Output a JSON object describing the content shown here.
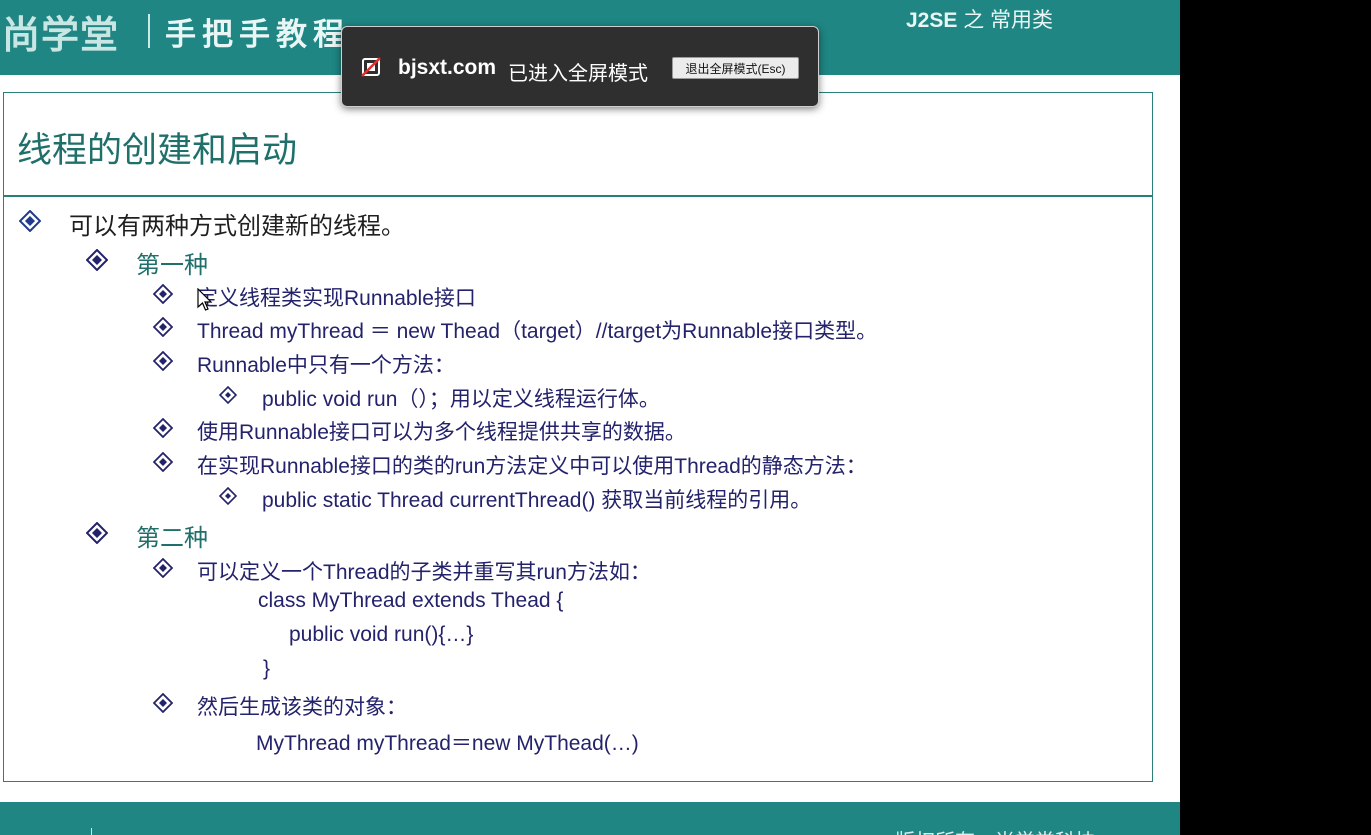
{
  "header": {
    "logo": "尚学堂",
    "motto": "手把手教程",
    "course_prefix": "J2SE",
    "course_suffix": "之 常用类"
  },
  "slide": {
    "title": "线程的创建和启动",
    "bullets": [
      {
        "level": 0,
        "text": "可以有两种方式创建新的线程。"
      },
      {
        "level": 1,
        "text": "第一种"
      },
      {
        "level": 2,
        "text": "定义线程类实现Runnable接口"
      },
      {
        "level": 2,
        "text": "Thread myThread ＝ new Thead（target）//target为Runnable接口类型。"
      },
      {
        "level": 2,
        "text": "Runnable中只有一个方法："
      },
      {
        "level": 3,
        "text": "public void run（）；用以定义线程运行体。"
      },
      {
        "level": 2,
        "text": "使用Runnable接口可以为多个线程提供共享的数据。"
      },
      {
        "level": 2,
        "text": "在实现Runnable接口的类的run方法定义中可以使用Thread的静态方法："
      },
      {
        "level": 3,
        "text": "public static Thread currentThread()  获取当前线程的引用。"
      },
      {
        "level": 1,
        "text": "第二种"
      },
      {
        "level": 2,
        "text": "可以定义一个Thread的子类并重写其run方法如："
      },
      {
        "level": -1,
        "text": "class MyThread extends Thead {"
      },
      {
        "level": -1,
        "text": "public void run(){…}"
      },
      {
        "level": -1,
        "text": "}"
      },
      {
        "level": 2,
        "text": "然后生成该类的对象："
      },
      {
        "level": -1,
        "text": "MyThread myThread＝new MyThead(…)"
      }
    ]
  },
  "footer": {
    "text": "版权所有：尚学堂科技"
  },
  "fullscreen_toast": {
    "domain": "bjsxt.com",
    "message": "已进入全屏模式",
    "exit_label": "退出全屏模式(Esc)",
    "icon": "fullscreen-blocked-icon"
  },
  "colors": {
    "brand_teal": "#1f8683",
    "text_navy": "#23226b",
    "toast_bg": "#2f2f2f"
  }
}
